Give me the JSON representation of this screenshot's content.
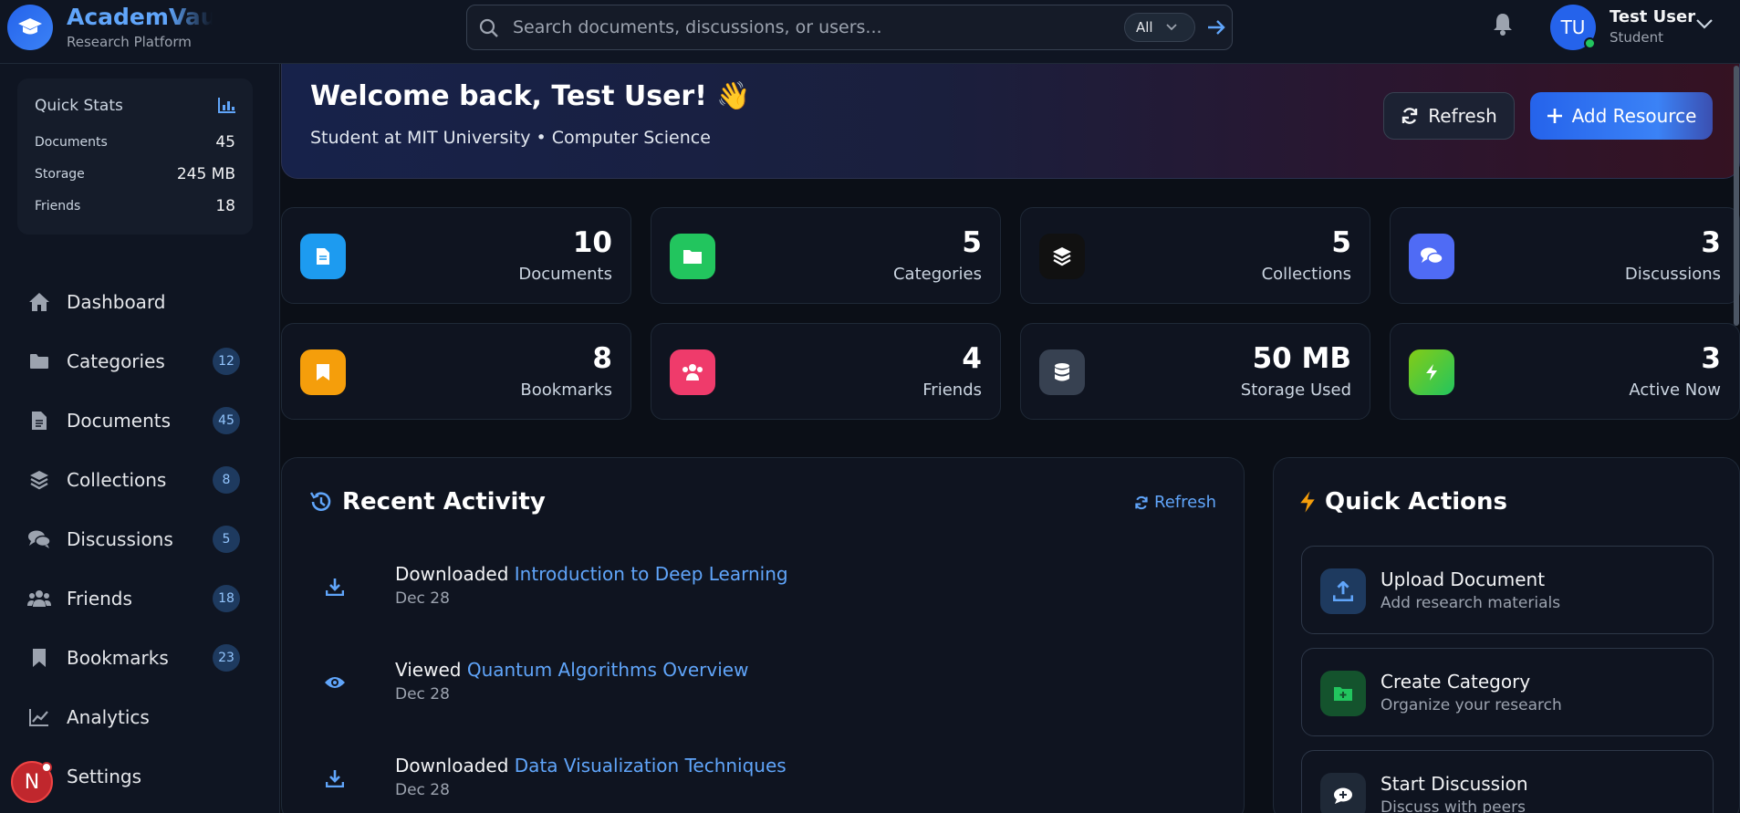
{
  "brand": {
    "name": "AcademVault",
    "subtitle": "Research Platform",
    "icon": "graduation-cap-icon"
  },
  "search": {
    "placeholder": "Search documents, discussions, or users...",
    "filter": "All"
  },
  "user": {
    "initials": "TU",
    "name": "Test User",
    "role": "Student"
  },
  "quick_stats": {
    "title": "Quick Stats",
    "rows": [
      {
        "label": "Documents",
        "value": "45"
      },
      {
        "label": "Storage",
        "value": "245 MB"
      },
      {
        "label": "Friends",
        "value": "18"
      }
    ]
  },
  "nav": [
    {
      "label": "Dashboard",
      "badge": "",
      "icon": "home-icon"
    },
    {
      "label": "Categories",
      "badge": "12",
      "icon": "folder-icon"
    },
    {
      "label": "Documents",
      "badge": "45",
      "icon": "file-icon"
    },
    {
      "label": "Collections",
      "badge": "8",
      "icon": "layers-icon"
    },
    {
      "label": "Discussions",
      "badge": "5",
      "icon": "comments-icon"
    },
    {
      "label": "Friends",
      "badge": "18",
      "icon": "users-icon"
    },
    {
      "label": "Bookmarks",
      "badge": "23",
      "icon": "bookmark-icon"
    },
    {
      "label": "Analytics",
      "badge": "",
      "icon": "chart-line-icon"
    },
    {
      "label": "Settings",
      "badge": "",
      "icon": "gear-icon"
    }
  ],
  "floating_badge": "N",
  "welcome": {
    "title": "Welcome back, Test User! 👋",
    "subtitle": "Student at MIT University • Computer Science",
    "refresh_label": "Refresh",
    "add_label": "Add Resource"
  },
  "stats": [
    {
      "value": "10",
      "label": "Documents",
      "color": "#1d9bf0"
    },
    {
      "value": "5",
      "label": "Categories",
      "color": "#22c55e"
    },
    {
      "value": "5",
      "label": "Collections",
      "color": "#111111"
    },
    {
      "value": "3",
      "label": "Discussions",
      "color": "#4f6bf5"
    },
    {
      "value": "8",
      "label": "Bookmarks",
      "color": "#f59e0b"
    },
    {
      "value": "4",
      "label": "Friends",
      "color": "#ef3b6b"
    },
    {
      "value": "50 MB",
      "label": "Storage Used",
      "color": "#374151"
    },
    {
      "value": "3",
      "label": "Active Now",
      "color": "#65c93a"
    }
  ],
  "recent_activity": {
    "title": "Recent Activity",
    "refresh_label": "Refresh",
    "items": [
      {
        "action": "Downloaded",
        "target": "Introduction to Deep Learning",
        "date": "Dec 28",
        "icon": "download-icon"
      },
      {
        "action": "Viewed",
        "target": "Quantum Algorithms Overview",
        "date": "Dec 28",
        "icon": "eye-icon"
      },
      {
        "action": "Downloaded",
        "target": "Data Visualization Techniques",
        "date": "Dec 28",
        "icon": "download-icon"
      }
    ]
  },
  "quick_actions": {
    "title": "Quick Actions",
    "items": [
      {
        "title": "Upload Document",
        "subtitle": "Add research materials",
        "color": "#1e3a5f"
      },
      {
        "title": "Create Category",
        "subtitle": "Organize your research",
        "color": "#14532d"
      },
      {
        "title": "Start Discussion",
        "subtitle": "Discuss with peers",
        "color": "#1f2937"
      }
    ]
  }
}
